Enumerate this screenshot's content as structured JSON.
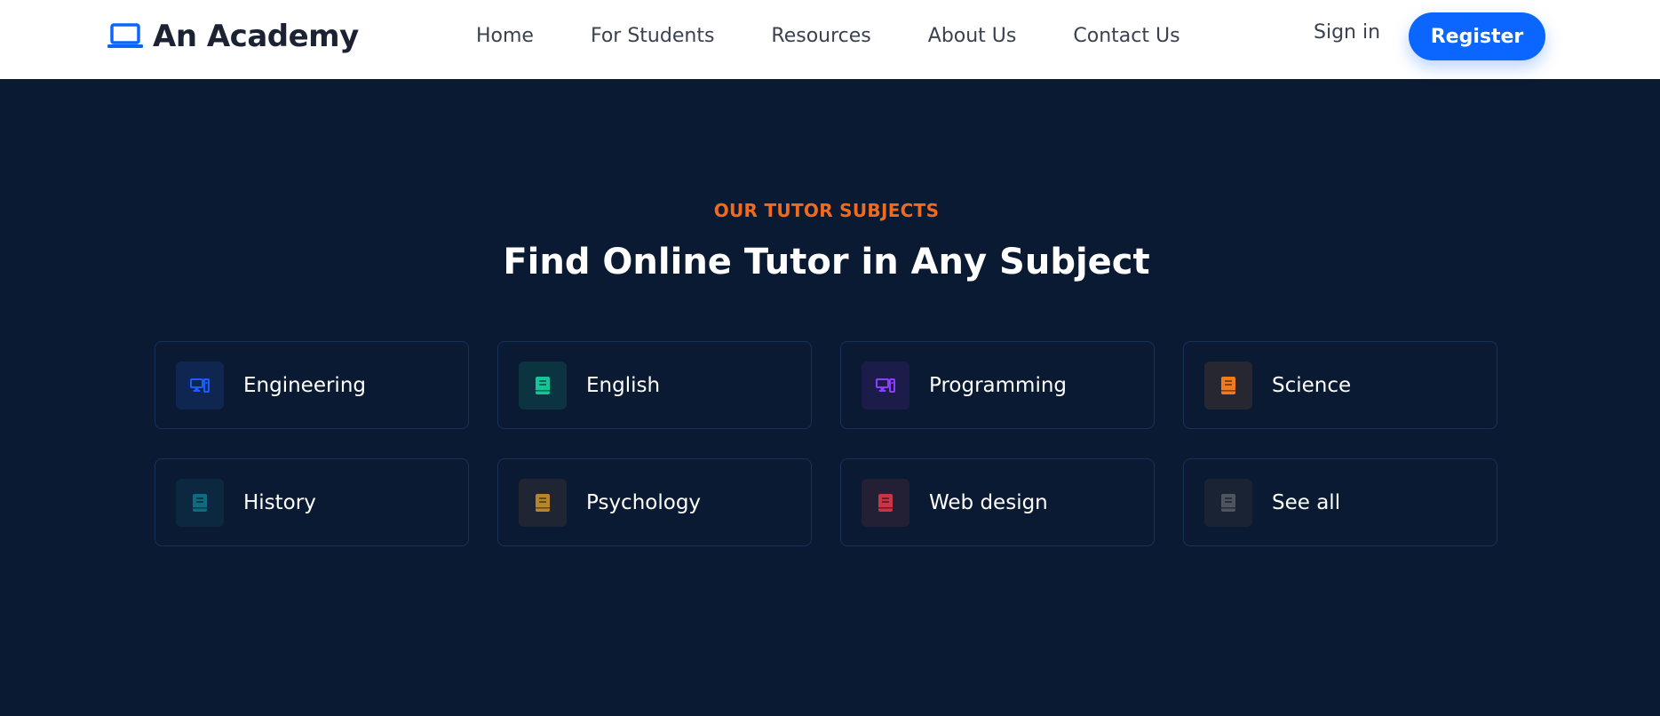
{
  "header": {
    "brand": "An Academy",
    "brand_icon": "laptop-icon",
    "brand_color": "#0a66ff",
    "nav": [
      {
        "label": "Home"
      },
      {
        "label": "For Students"
      },
      {
        "label": "Resources"
      },
      {
        "label": "About Us"
      },
      {
        "label": "Contact Us"
      }
    ],
    "signin_label": "Sign in",
    "register_label": "Register"
  },
  "section": {
    "eyebrow": "OUR TUTOR SUBJECTS",
    "title": "Find Online Tutor in Any Subject",
    "subjects": [
      {
        "label": "Engineering",
        "icon": "computer-icon",
        "color": "#1a5cff",
        "bg": "#0f2750"
      },
      {
        "label": "English",
        "icon": "book-icon",
        "color": "#19c39a",
        "bg": "#0b3440"
      },
      {
        "label": "Programming",
        "icon": "computer-icon",
        "color": "#8a3ffc",
        "bg": "#1c1c4a"
      },
      {
        "label": "Science",
        "icon": "book-icon",
        "color": "#f07a1e",
        "bg": "#262730"
      },
      {
        "label": "History",
        "icon": "book-icon",
        "color": "#0f6b80",
        "bg": "#0c2740"
      },
      {
        "label": "Psychology",
        "icon": "book-icon",
        "color": "#b9852b",
        "bg": "#1f2532"
      },
      {
        "label": "Web design",
        "icon": "book-icon",
        "color": "#c83545",
        "bg": "#231f34"
      },
      {
        "label": "See all",
        "icon": "book-icon",
        "color": "#4e5462",
        "bg": "#1a2334"
      }
    ]
  }
}
